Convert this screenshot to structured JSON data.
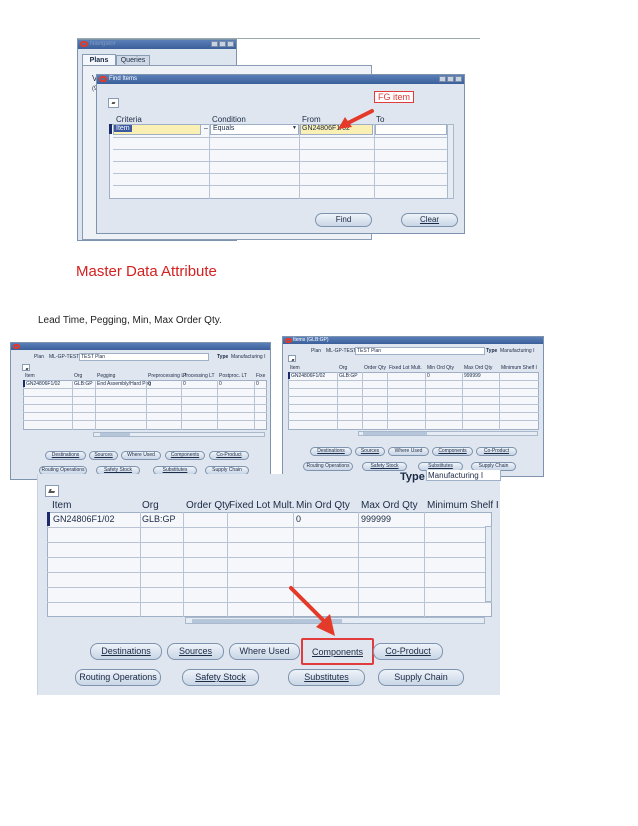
{
  "find_screenshot": {
    "parent_title": "Navigator",
    "tabs": [
      "Plans",
      "Queries"
    ],
    "tree_label_1": "V",
    "tree_label_2": "(9)",
    "dialog_title": "Find Items",
    "headers": {
      "criteria": "Criteria",
      "condition": "Condition",
      "from": "From",
      "to": "To"
    },
    "row": {
      "criteria": "Item",
      "condition": "Equals",
      "from": "GN24806F1/02"
    },
    "annotation": "FG item",
    "buttons": {
      "find": "Find",
      "clear": "Clear"
    }
  },
  "section_heading": "Master Data Attribute",
  "lead_text": "Lead Time, Pegging, Min, Max Order Qty.",
  "small_left": {
    "plan_label": "Plan",
    "plan_value": "ML-GP-TEST",
    "plan_desc": "TEST Plan",
    "type_label": "Type",
    "type_value": "Manufacturing I",
    "columns": [
      "Item",
      "Org",
      "Pegging",
      "Preprocessing LT",
      "Processing LT",
      "Postproc. LT",
      "Fixe"
    ],
    "row": [
      "GN24806F1/02",
      "GLB:GP",
      "End Assembly/Hard Peg",
      "0",
      "0",
      "0",
      "0"
    ],
    "buttons_row1": [
      "Destinations",
      "Sources",
      "Where Used",
      "Components",
      "Co-Product"
    ],
    "buttons_row2": [
      "Routing Operations",
      "Safety Stock",
      "Substitutes",
      "Supply Chain"
    ]
  },
  "small_right": {
    "title": "Items (GLB:GP)",
    "plan_label": "Plan",
    "plan_value": "ML-GP-TEST",
    "plan_desc": "TEST Plan",
    "type_label": "Type",
    "type_value": "Manufacturing I",
    "columns": [
      "Item",
      "Org",
      "Order Qty",
      "Fixed Lot Mult.",
      "Min Ord Qty",
      "Max Ord Qty",
      "Minimum Shelf I"
    ],
    "row": [
      "GN24806F1/02",
      "GLB:GP",
      "",
      "",
      "0",
      "999999",
      ""
    ],
    "buttons_row1": [
      "Destinations",
      "Sources",
      "Where Used",
      "Components",
      "Co-Product"
    ],
    "buttons_row2": [
      "Routing Operations",
      "Safety Stock",
      "Substitutes",
      "Supply Chain"
    ]
  },
  "large": {
    "type_partial": "Type",
    "type_value_partial": "Manufacturing I",
    "columns": [
      "Item",
      "Org",
      "Order Qty",
      "Fixed Lot Mult.",
      "Min Ord Qty",
      "Max Ord Qty",
      "Minimum Shelf I"
    ],
    "row": [
      "GN24806F1/02",
      "GLB:GP",
      "",
      "",
      "0",
      "999999",
      ""
    ],
    "buttons_row1": [
      "Destinations",
      "Sources",
      "Where Used",
      "Components",
      "Co-Product"
    ],
    "buttons_row2": [
      "Routing Operations",
      "Safety Stock",
      "Substitutes",
      "Supply Chain"
    ]
  },
  "colors": {
    "heading_red": "#d61f1f",
    "highlight_red": "#e23b3b",
    "oracle_red": "#e13a2a",
    "window_bg": "#dde5ee"
  },
  "icons": [
    "oracle-logo-icon",
    "toolbar-edit-icon",
    "red-arrow-icon"
  ]
}
